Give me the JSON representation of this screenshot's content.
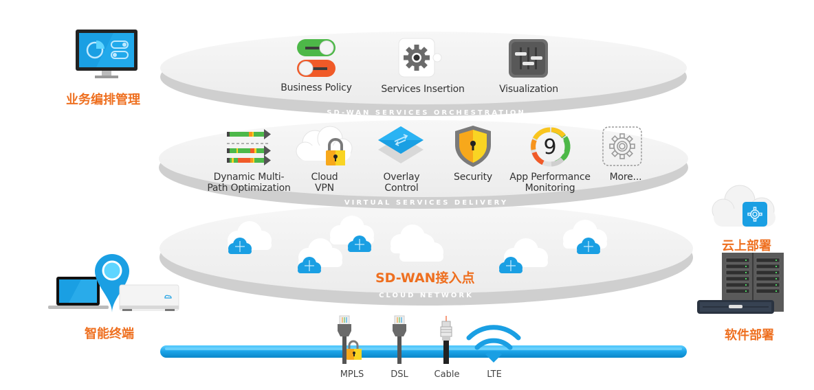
{
  "layers": {
    "orchestration": {
      "band_label": "SD-WAN SERVICES ORCHESTRATION",
      "items": [
        {
          "label": "Business Policy",
          "icon": "toggle-switches-icon"
        },
        {
          "label": "Services Insertion",
          "icon": "gear-puzzle-icon"
        },
        {
          "label": "Visualization",
          "icon": "sliders-icon"
        }
      ]
    },
    "virtual_services": {
      "band_label": "VIRTUAL SERVICES DELIVERY",
      "items": [
        {
          "label_line1": "Dynamic Multi-",
          "label_line2": "Path Optimization",
          "icon": "multipath-arrows-icon"
        },
        {
          "label_line1": "Cloud",
          "label_line2": "VPN",
          "icon": "cloud-lock-icon"
        },
        {
          "label_line1": "Overlay",
          "label_line2": "Control",
          "icon": "overlay-layers-icon"
        },
        {
          "label_line1": "Security",
          "label_line2": "",
          "icon": "shield-icon"
        },
        {
          "label_line1": "App Performance",
          "label_line2": "Monitoring",
          "icon": "score-gauge-icon",
          "gauge_value": "9"
        },
        {
          "label_line1": "More...",
          "label_line2": "",
          "icon": "gear-outline-icon"
        }
      ]
    },
    "cloud_network": {
      "band_label": "CLOUD NETWORK",
      "center_label": "SD-WAN接入点"
    }
  },
  "side_labels": {
    "orchestration_mgmt": "业务编排管理",
    "smart_terminal": "智能终端",
    "cloud_deploy": "云上部署",
    "software_deploy": "软件部署"
  },
  "transports": [
    {
      "label": "MPLS",
      "icon": "ethernet-lock-icon"
    },
    {
      "label": "DSL",
      "icon": "ethernet-icon"
    },
    {
      "label": "Cable",
      "icon": "coax-cable-icon"
    },
    {
      "label": "LTE",
      "icon": "wifi-signal-icon"
    }
  ],
  "colors": {
    "accent_orange": "#ee6f1f",
    "accent_blue": "#1aa3e8",
    "band_gray": "#c9c9c9"
  }
}
